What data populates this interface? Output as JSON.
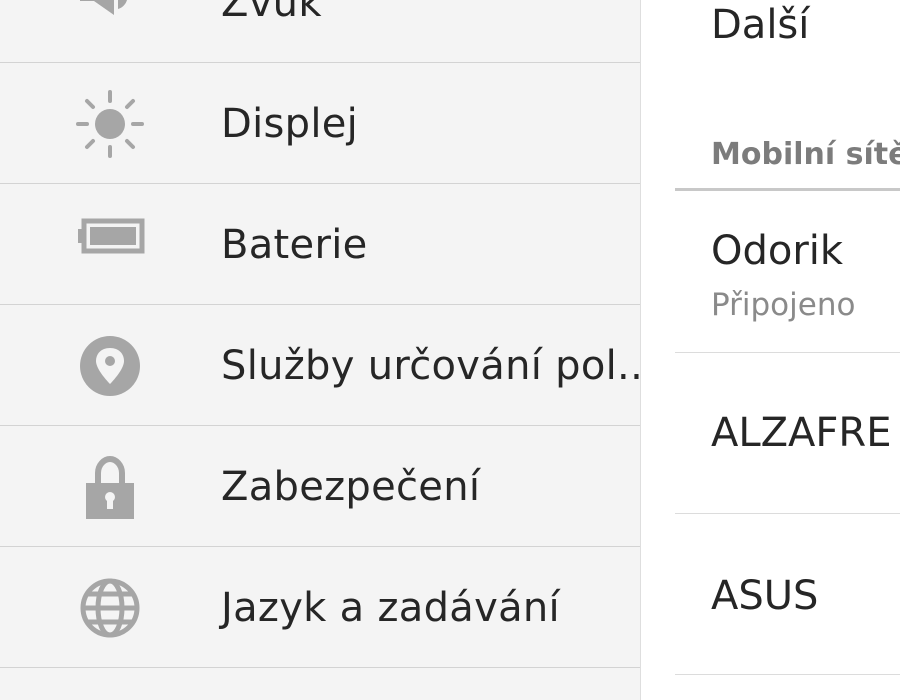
{
  "settings_list": {
    "items": [
      {
        "label": "Zvuk",
        "icon": "volume-icon"
      },
      {
        "label": "Displej",
        "icon": "brightness-icon"
      },
      {
        "label": "Baterie",
        "icon": "battery-icon"
      },
      {
        "label": "Služby určování pol..",
        "icon": "location-icon"
      },
      {
        "label": "Zabezpečení",
        "icon": "lock-icon"
      },
      {
        "label": "Jazyk a zadávání",
        "icon": "globe-icon"
      }
    ]
  },
  "detail_pane": {
    "more_label": "Další",
    "section_header": "Mobilní sítě",
    "networks": [
      {
        "name": "Odorik",
        "status": "Připojeno"
      },
      {
        "name": "ALZAFRE",
        "status": ""
      },
      {
        "name": "ASUS",
        "status": ""
      }
    ]
  },
  "colors": {
    "left_background": "#f4f4f4",
    "right_background": "#ffffff",
    "icon_gray": "#a6a6a6",
    "text_primary": "#262626",
    "text_secondary": "#8a8a8a",
    "section_header": "#7c7c7c"
  }
}
